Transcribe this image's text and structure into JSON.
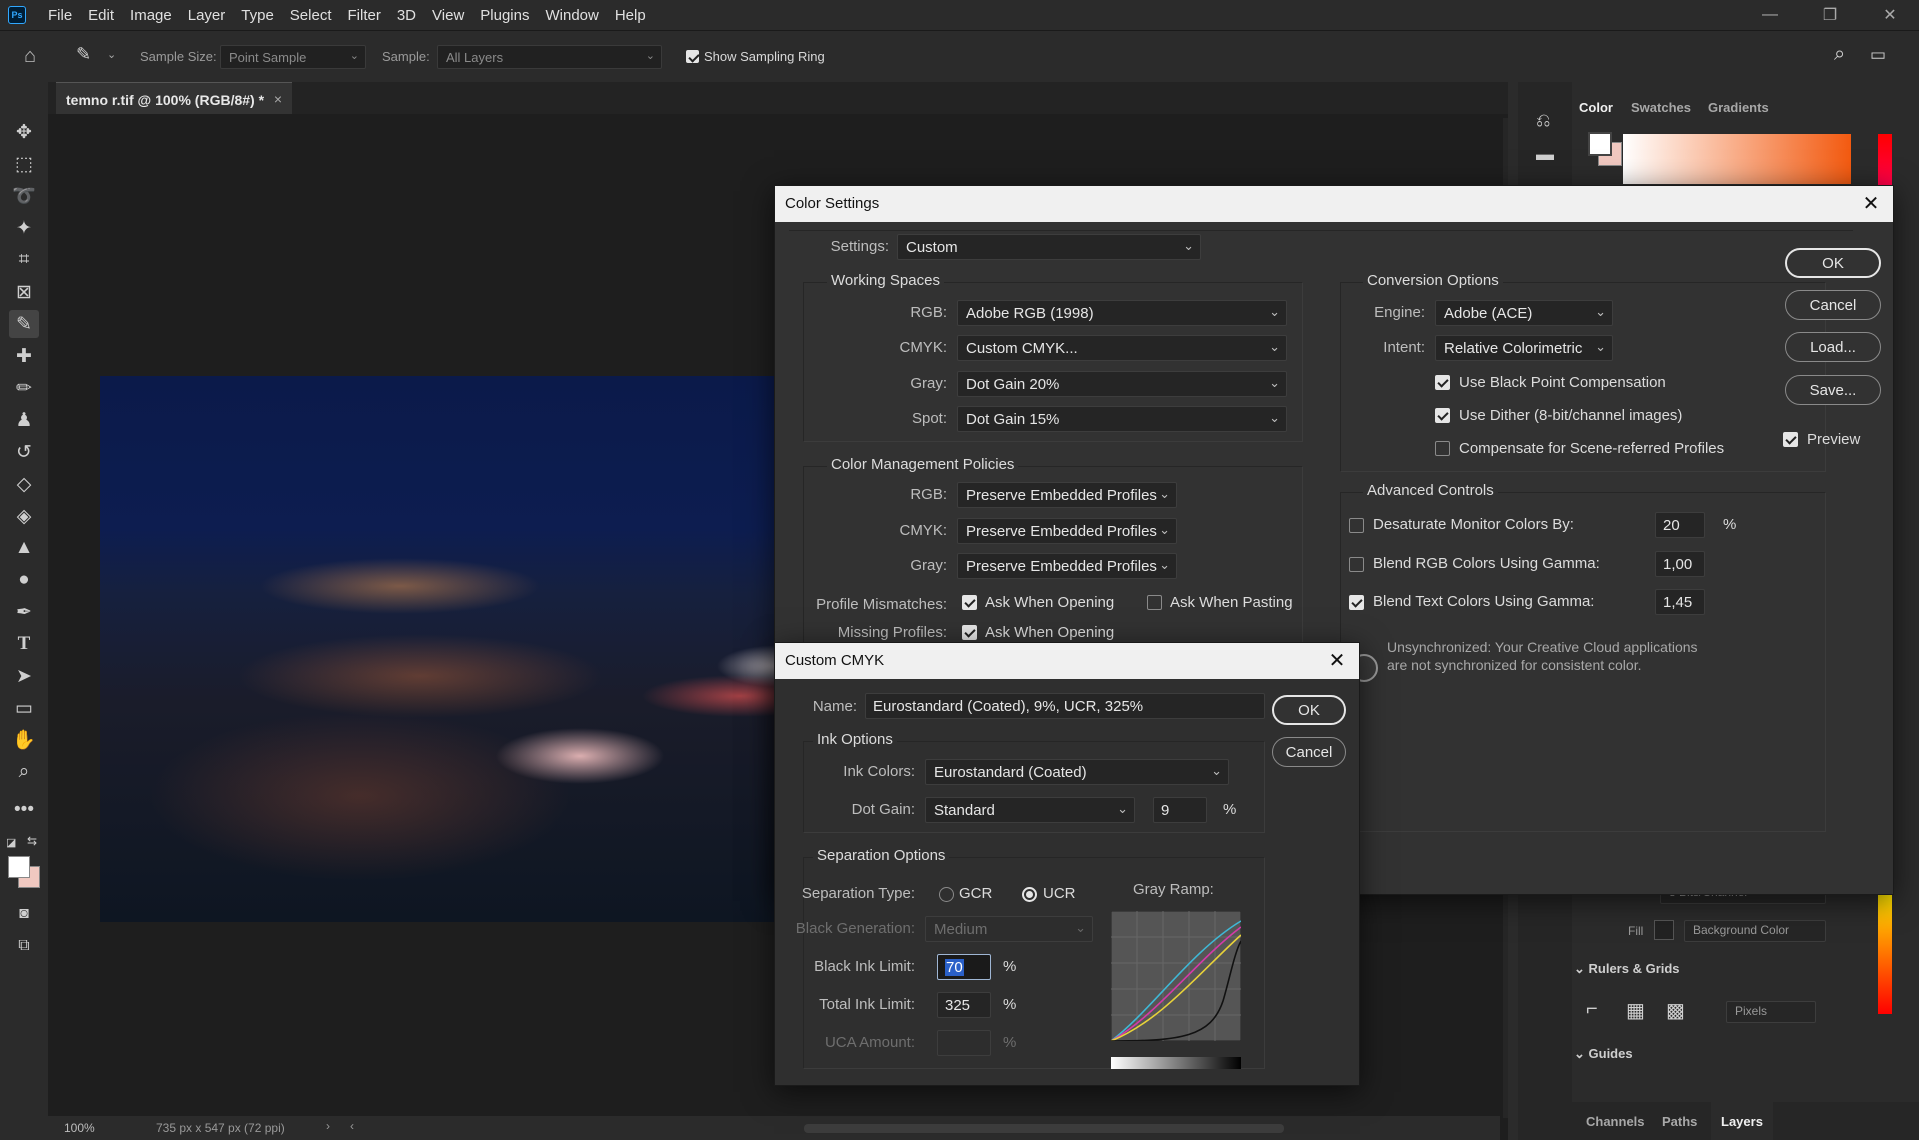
{
  "app": {
    "logo": "Ps"
  },
  "menu": [
    "File",
    "Edit",
    "Image",
    "Layer",
    "Type",
    "Select",
    "Filter",
    "3D",
    "View",
    "Plugins",
    "Window",
    "Help"
  ],
  "options_bar": {
    "sample_size_label": "Sample Size:",
    "sample_size_value": "Point Sample",
    "sample_label": "Sample:",
    "sample_value": "All Layers",
    "show_sampling_ring_label": "Show Sampling Ring",
    "show_sampling_ring_checked": true
  },
  "document": {
    "tab_title": "temno r.tif @ 100% (RGB/8#) *",
    "close_glyph": "×"
  },
  "status": {
    "zoom": "100%",
    "info": "735 px x 547 px (72 ppi)"
  },
  "right_panel": {
    "tabs": [
      "Color",
      "Swatches",
      "Gradients"
    ],
    "bits_value": "8 Bits/Channel",
    "fill_label": "Fill",
    "fill_value": "Background Color",
    "rulers_grids_title": "Rulers & Grids",
    "units_value": "Pixels",
    "guides_title": "Guides",
    "bottom_tabs": [
      "Channels",
      "Paths",
      "Layers"
    ]
  },
  "color_settings": {
    "title": "Color Settings",
    "settings_label": "Settings:",
    "settings_value": "Custom",
    "working_spaces": {
      "title": "Working Spaces",
      "rgb_label": "RGB:",
      "rgb_value": "Adobe RGB (1998)",
      "cmyk_label": "CMYK:",
      "cmyk_value": "Custom CMYK...",
      "gray_label": "Gray:",
      "gray_value": "Dot Gain 20%",
      "spot_label": "Spot:",
      "spot_value": "Dot Gain 15%"
    },
    "policies": {
      "title": "Color Management Policies",
      "rgb_label": "RGB:",
      "rgb_value": "Preserve Embedded Profiles",
      "cmyk_label": "CMYK:",
      "cmyk_value": "Preserve Embedded Profiles",
      "gray_label": "Gray:",
      "gray_value": "Preserve Embedded Profiles",
      "mismatch_label": "Profile Mismatches:",
      "ask_opening_label": "Ask When Opening",
      "ask_pasting_label": "Ask When Pasting",
      "missing_label": "Missing Profiles:",
      "missing_ask_label": "Ask When Opening"
    },
    "conversion": {
      "title": "Conversion Options",
      "engine_label": "Engine:",
      "engine_value": "Adobe (ACE)",
      "intent_label": "Intent:",
      "intent_value": "Relative Colorimetric",
      "bpc_label": "Use Black Point Compensation",
      "bpc_checked": true,
      "dither_label": "Use Dither (8-bit/channel images)",
      "dither_checked": true,
      "scene_label": "Compensate for Scene-referred Profiles",
      "scene_checked": false
    },
    "advanced": {
      "title": "Advanced Controls",
      "desaturate_label": "Desaturate Monitor Colors By:",
      "desaturate_value": "20",
      "desaturate_unit": "%",
      "desaturate_checked": false,
      "blend_rgb_label": "Blend RGB Colors Using Gamma:",
      "blend_rgb_value": "1,00",
      "blend_rgb_checked": false,
      "blend_text_label": "Blend Text Colors Using Gamma:",
      "blend_text_value": "1,45",
      "blend_text_checked": true
    },
    "sync_message_line1": "Unsynchronized: Your Creative Cloud applications",
    "sync_message_line2": "are not synchronized for consistent color.",
    "buttons": {
      "ok": "OK",
      "cancel": "Cancel",
      "load": "Load...",
      "save": "Save..."
    },
    "preview_label": "Preview",
    "preview_checked": true
  },
  "custom_cmyk": {
    "title": "Custom CMYK",
    "name_label": "Name:",
    "name_value": "Eurostandard (Coated), 9%, UCR, 325%",
    "ok": "OK",
    "cancel": "Cancel",
    "ink_options": {
      "title": "Ink Options",
      "ink_colors_label": "Ink Colors:",
      "ink_colors_value": "Eurostandard (Coated)",
      "dot_gain_label": "Dot Gain:",
      "dot_gain_value": "Standard",
      "dot_gain_amount": "9",
      "dot_gain_unit": "%"
    },
    "separation": {
      "title": "Separation Options",
      "type_label": "Separation Type:",
      "gcr_label": "GCR",
      "ucr_label": "UCR",
      "selected": "UCR",
      "black_gen_label": "Black Generation:",
      "black_gen_value": "Medium",
      "black_ink_limit_label": "Black Ink Limit:",
      "black_ink_limit_value": "70",
      "black_ink_limit_unit": "%",
      "total_ink_limit_label": "Total Ink Limit:",
      "total_ink_limit_value": "325",
      "total_ink_limit_unit": "%",
      "uca_label": "UCA Amount:",
      "uca_value": "",
      "uca_unit": "%",
      "gray_ramp_label": "Gray Ramp:"
    }
  },
  "colors": {
    "accent_selection": "#2a60c8",
    "dialog_bg": "#323232",
    "titlebar_bg": "#f0f0f0"
  }
}
